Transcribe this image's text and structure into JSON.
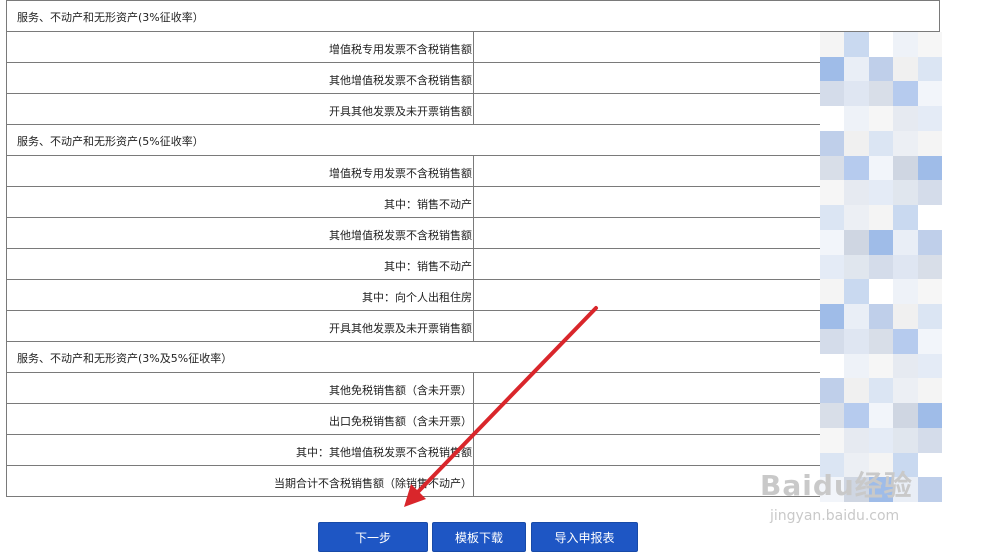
{
  "rows": [
    {
      "kind": "section",
      "label": "服务、不动产和无形资产(3%征收率）"
    },
    {
      "kind": "field",
      "label": "增值税专用发票不含税销售额"
    },
    {
      "kind": "field",
      "label": "其他增值税发票不含税销售额"
    },
    {
      "kind": "field",
      "label": "开具其他发票及未开票销售额"
    },
    {
      "kind": "section",
      "label": "服务、不动产和无形资产(5%征收率）"
    },
    {
      "kind": "field",
      "label": "增值税专用发票不含税销售额"
    },
    {
      "kind": "field",
      "label": "其中：销售不动产"
    },
    {
      "kind": "field",
      "label": "其他增值税发票不含税销售额"
    },
    {
      "kind": "field",
      "label": "其中：销售不动产"
    },
    {
      "kind": "field",
      "label": "其中：向个人出租住房"
    },
    {
      "kind": "field",
      "label": "开具其他发票及未开票销售额"
    },
    {
      "kind": "section",
      "label": "服务、不动产和无形资产(3%及5%征收率）"
    },
    {
      "kind": "field",
      "label": "其他免税销售额（含未开票）"
    },
    {
      "kind": "field",
      "label": "出口免税销售额（含未开票）"
    },
    {
      "kind": "field",
      "label": "其中：其他增值税发票不含税销售额"
    },
    {
      "kind": "field",
      "label": "当期合计不含税销售额（除销售不动产）"
    }
  ],
  "buttons": {
    "next": "下一步",
    "template_download": "模板下载",
    "import_report": "导入申报表"
  },
  "watermark": {
    "logo_text": "Baidu经验",
    "url_text": "jingyan.baidu.com"
  },
  "colors": {
    "button_blue": "#1e56c4",
    "arrow_red": "#d9262b",
    "border_gray": "#7a7a7a"
  },
  "blur_colors": [
    "#f4f4f4",
    "#eef2f8",
    "#e4ebf6",
    "#dfe6f2",
    "#f2f5fa",
    "#e9eef6",
    "#dbe5f3",
    "#c9d9f0",
    "#f6f6f6",
    "#e0e6ee",
    "#d8dee8",
    "#cfd6e2",
    "#bfcfea",
    "#eceff4",
    "#ffffff",
    "#e6eaf1",
    "#d4dcea",
    "#b6cbee",
    "#9fbce8",
    "#f0f0f0"
  ]
}
